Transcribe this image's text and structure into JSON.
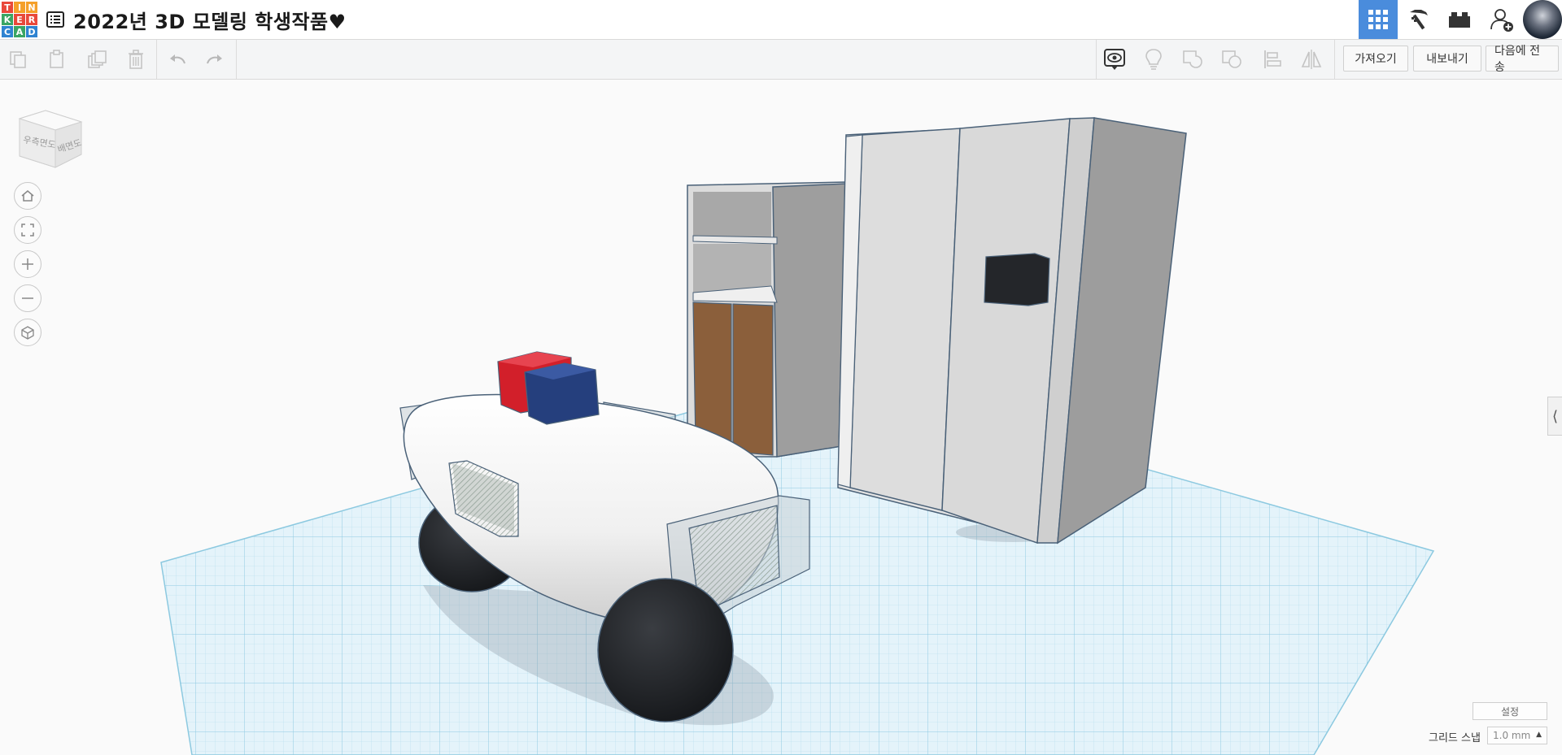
{
  "app": {
    "logo_letters": [
      "T",
      "I",
      "N",
      "K",
      "E",
      "R",
      "C",
      "A",
      "D"
    ],
    "logo_colors": [
      "#e9493b",
      "#f5a02a",
      "#f5a02a",
      "#3aa564",
      "#e9493b",
      "#e9493b",
      "#2f83d1",
      "#3aa564",
      "#2f83d1"
    ],
    "accent": "#4a8cdc"
  },
  "header": {
    "doc_title": "2022년 3D 모델링 학생작품♥",
    "icons": [
      "list-icon",
      "grid-icon",
      "pickaxe-icon",
      "brick-icon",
      "add-user-icon"
    ]
  },
  "toolbar": {
    "import_label": "가져오기",
    "export_label": "내보내기",
    "send_label": "다음에 전송"
  },
  "viewcube": {
    "front_label": "우측면도",
    "back_label": "배면도"
  },
  "settings": {
    "settings_label": "설정",
    "snap_label": "그리드 스냅",
    "snap_value": "1.0 mm"
  }
}
